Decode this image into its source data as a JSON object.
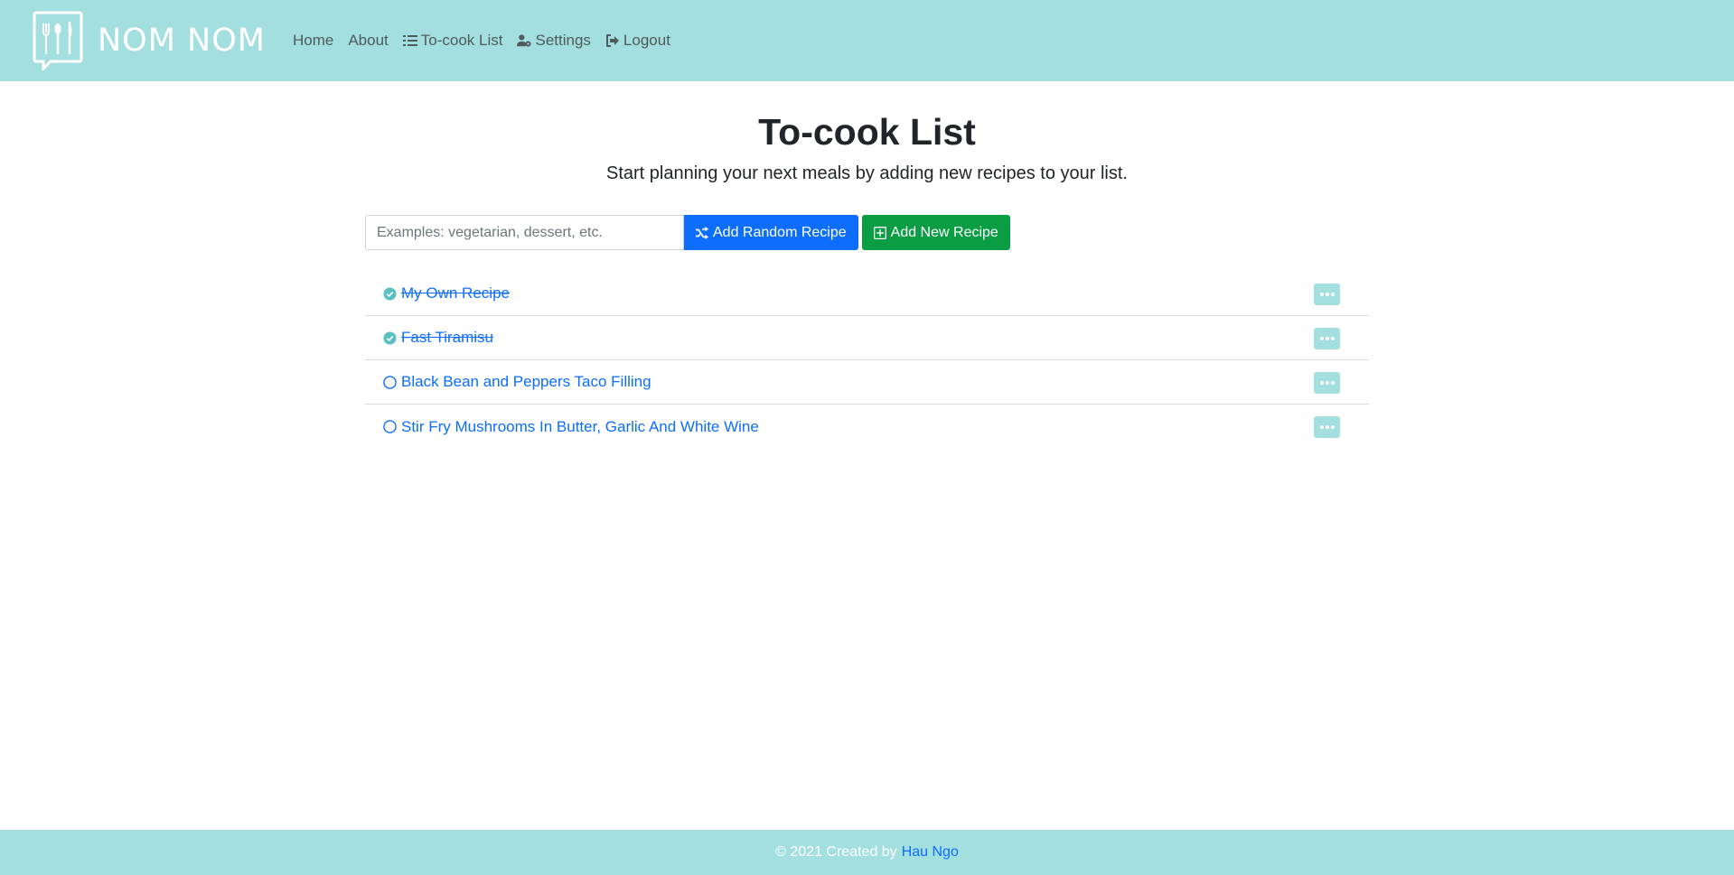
{
  "nav": {
    "brand": "NOM NOM",
    "links": [
      {
        "label": "Home",
        "icon": ""
      },
      {
        "label": "About",
        "icon": ""
      },
      {
        "label": "To-cook List",
        "icon": "list-icon"
      },
      {
        "label": "Settings",
        "icon": "user-gear-icon"
      },
      {
        "label": "Logout",
        "icon": "logout-icon"
      }
    ]
  },
  "main": {
    "title": "To-cook List",
    "subtitle": "Start planning your next meals by adding new recipes to your list.",
    "search_placeholder": "Examples: vegetarian, dessert, etc.",
    "random_button": "Add Random Recipe",
    "new_button": "Add New Recipe"
  },
  "recipes": [
    {
      "name": "My Own Recipe",
      "done": true
    },
    {
      "name": "Fast Tiramisu",
      "done": true
    },
    {
      "name": "Black Bean and Peppers Taco Filling",
      "done": false
    },
    {
      "name": "Stir Fry Mushrooms In Butter, Garlic And White Wine",
      "done": false
    }
  ],
  "footer": {
    "text": "© 2021 Created by",
    "author": "Hau Ngo"
  },
  "colors": {
    "navbar_bg": "#a3dfdf",
    "primary": "#0d6efd",
    "success": "#0a9d43"
  }
}
